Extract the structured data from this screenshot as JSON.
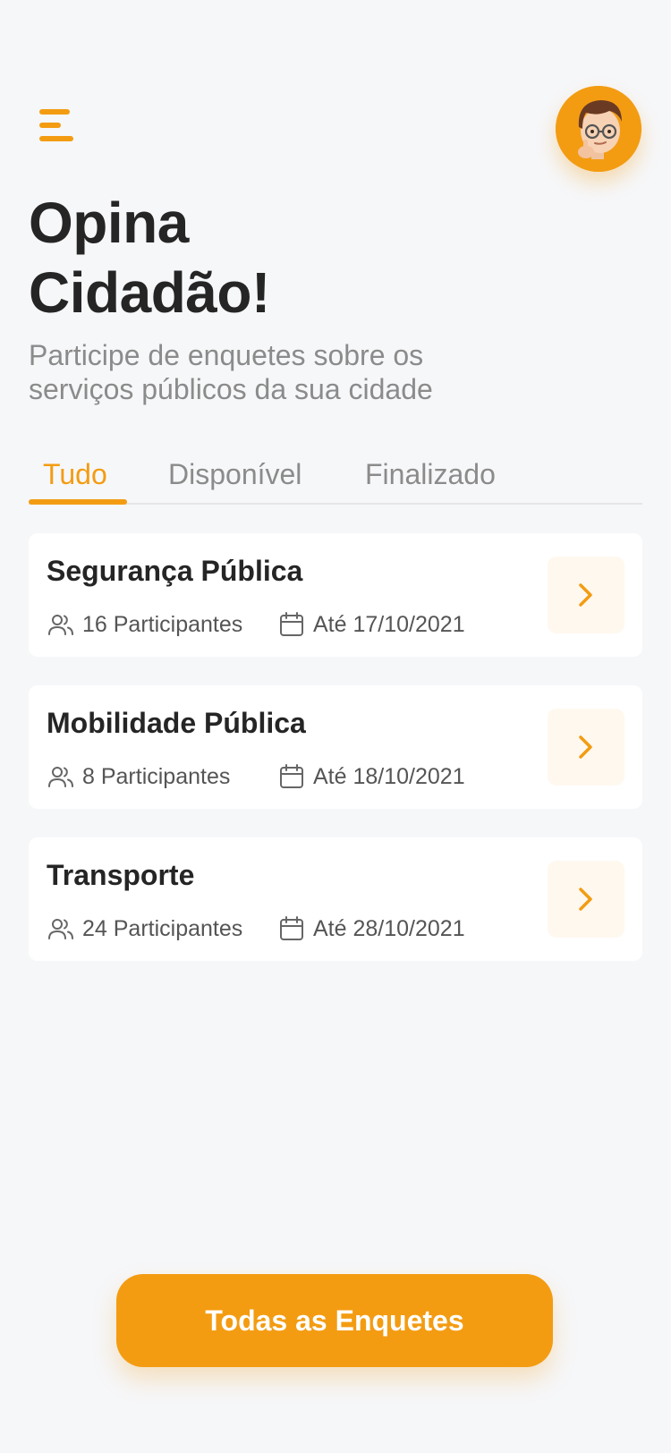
{
  "header": {
    "menu_icon": "hamburger-menu-icon",
    "avatar_icon": "user-avatar",
    "title_line1": "Opina",
    "title_line2": "Cidadão!",
    "subtitle": "Participe de enquetes sobre os serviços públicos da sua cidade"
  },
  "tabs": [
    {
      "label": "Tudo",
      "active": true
    },
    {
      "label": "Disponível",
      "active": false
    },
    {
      "label": "Finalizado",
      "active": false
    }
  ],
  "polls": [
    {
      "title": "Segurança Pública",
      "participants": "16 Participantes",
      "deadline": "Até 17/10/2021"
    },
    {
      "title": "Mobilidade Pública",
      "participants": "8 Participantes",
      "deadline": "Até 18/10/2021"
    },
    {
      "title": "Transporte",
      "participants": "24 Participantes",
      "deadline": "Até 28/10/2021"
    }
  ],
  "cta": {
    "label": "Todas as Enquetes"
  },
  "colors": {
    "accent": "#f39c12",
    "background": "#f6f7f9",
    "card": "#ffffff",
    "text": "#252525",
    "muted": "#8b8b8b"
  }
}
